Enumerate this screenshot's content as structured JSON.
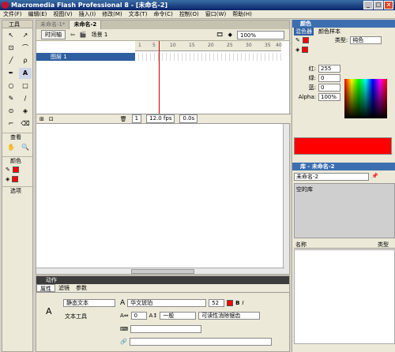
{
  "app": {
    "title": "Macromedia Flash Professional 8 - [未命名-2]"
  },
  "window": {
    "min": "_",
    "max": "□",
    "close": "×"
  },
  "menu": [
    "文件(F)",
    "编辑(E)",
    "视图(V)",
    "插入(I)",
    "修改(M)",
    "文本(T)",
    "命令(C)",
    "控制(O)",
    "窗口(W)",
    "帮助(H)"
  ],
  "toolbox": {
    "title": "工具",
    "tools": [
      "↖",
      "↗",
      "⊡",
      "⌒",
      "╱",
      "ρ",
      "✒",
      "A",
      "○",
      "□",
      "✎",
      "∕",
      "⊙",
      "◈",
      "⌐",
      "⌫"
    ],
    "view_label": "查看",
    "view_tools": [
      "✋",
      "🔍"
    ],
    "color_label": "颜色",
    "options_label": "选项"
  },
  "document": {
    "tabs": [
      "未命名-1*",
      "未命名-2"
    ],
    "timeline_button": "时间轴",
    "scene": "场景 1",
    "zoom": "100%",
    "ruler": [
      "1",
      "5",
      "10",
      "15",
      "20",
      "25",
      "30",
      "35",
      "40"
    ],
    "layer_name": "图层 1",
    "frame": "1",
    "fps": "12.0 fps",
    "time": "0.0s"
  },
  "color_panel": {
    "title": "颜色",
    "tabs": [
      "混色器",
      "颜色样本"
    ],
    "type_label": "类型:",
    "type_value": "纯色",
    "red_label": "红:",
    "red": "255",
    "green_label": "绿:",
    "green": "0",
    "blue_label": "蓝:",
    "blue": "0",
    "alpha_label": "Alpha:",
    "alpha": "100%",
    "hex": "#FF0000",
    "swatch": "#ff0000"
  },
  "library_panel": {
    "title": "库 - 未命名-2",
    "doc": "未命名-2",
    "empty": "空的库",
    "col_name": "名称",
    "col_type": "类型"
  },
  "actions_panel": {
    "title": "动作"
  },
  "properties": {
    "tabs": [
      "属性",
      "滤镜",
      "参数"
    ],
    "text_type": "静态文本",
    "tool_label": "文本工具",
    "font": "华文琥珀",
    "size": "52",
    "tracking": "0",
    "kerning": "一般",
    "render": "可读性消除锯齿"
  }
}
